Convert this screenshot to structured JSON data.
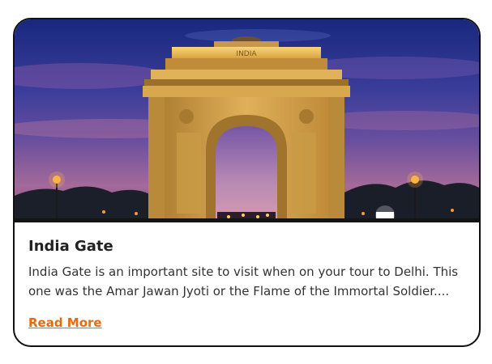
{
  "card": {
    "image": {
      "subject": "india-gate-night-photo",
      "inscription": "INDIA"
    },
    "title": "India Gate",
    "description": "India Gate is an important site to visit when on your tour to Delhi. This one was the Amar Jawan Jyoti or the Flame of the Immortal Soldier....",
    "read_more_label": "Read More",
    "colors": {
      "link": "#e86a10",
      "border": "#111111",
      "sky_top": "#1f2f8e",
      "sky_bottom": "#a06090",
      "stone": "#d6a34a"
    }
  }
}
